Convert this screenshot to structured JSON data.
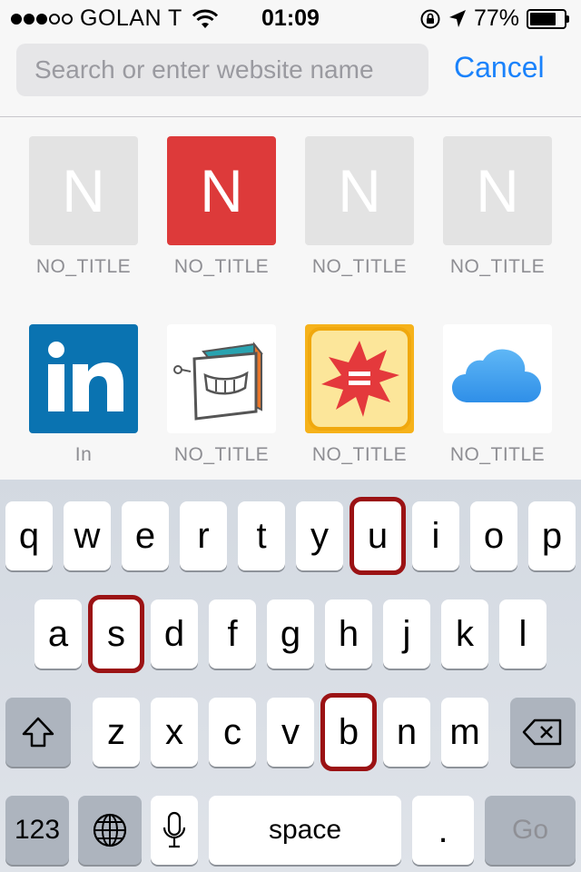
{
  "status_bar": {
    "signal_dots": [
      true,
      true,
      true,
      false,
      false
    ],
    "carrier": "GOLAN T",
    "time": "01:09",
    "battery_pct": "77%",
    "battery_level": 0.77
  },
  "search": {
    "placeholder": "Search or enter website name",
    "cancel_label": "Cancel"
  },
  "favorites": [
    {
      "letter": "N",
      "label": "NO_TITLE",
      "style": "gray"
    },
    {
      "letter": "N",
      "label": "NO_TITLE",
      "style": "red",
      "color": "#dd3a3a"
    },
    {
      "letter": "N",
      "label": "NO_TITLE",
      "style": "gray"
    },
    {
      "letter": "N",
      "label": "NO_TITLE",
      "style": "gray"
    },
    {
      "label": "In",
      "icon": "linkedin-icon",
      "color": "#0a73b1"
    },
    {
      "label": "NO_TITLE",
      "icon": "cube-robot-icon"
    },
    {
      "label": "NO_TITLE",
      "icon": "starburst-equals-icon"
    },
    {
      "label": "NO_TITLE",
      "icon": "icloud-icon"
    }
  ],
  "keyboard": {
    "row1": [
      "q",
      "w",
      "e",
      "r",
      "t",
      "y",
      "u",
      "i",
      "o",
      "p"
    ],
    "row2": [
      "a",
      "s",
      "d",
      "f",
      "g",
      "h",
      "j",
      "k",
      "l"
    ],
    "row3": [
      "z",
      "x",
      "c",
      "v",
      "b",
      "n",
      "m"
    ],
    "bottom": {
      "numbers": "123",
      "space": "space",
      "period": ".",
      "go": "Go"
    },
    "highlighted_keys": [
      "u",
      "s",
      "b"
    ],
    "highlight_color": "#9b1214"
  }
}
